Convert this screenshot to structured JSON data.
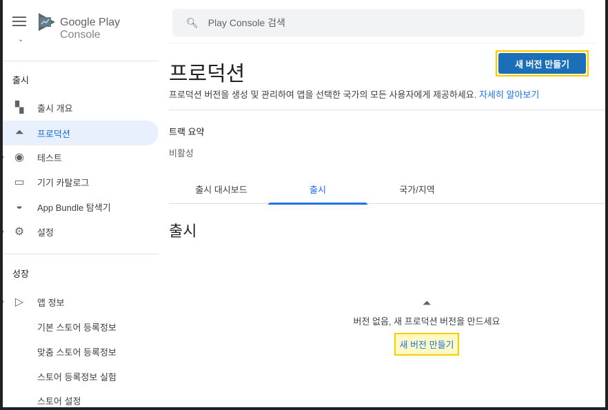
{
  "brand": {
    "name": "Google Play",
    "suffix": "Console"
  },
  "search": {
    "placeholder": "Play Console 검색"
  },
  "sidebar": {
    "release_section": "출시",
    "items": [
      {
        "label": "출시 개요"
      },
      {
        "label": "프로덕션"
      },
      {
        "label": "테스트"
      },
      {
        "label": "기기 카탈로그"
      },
      {
        "label": "App Bundle 탐색기"
      },
      {
        "label": "설정"
      }
    ],
    "growth_section": "성장",
    "growth_items": [
      {
        "label": "앱 정보"
      },
      {
        "label": "기본 스토어 등록정보"
      },
      {
        "label": "맞춤 스토어 등록정보"
      },
      {
        "label": "스토어 등록정보 실험"
      },
      {
        "label": "스토어 설정"
      }
    ]
  },
  "main": {
    "title": "프로덕션",
    "description": "프로덕션 버전을 생성 및 관리하여 앱을 선택한 국가의 모든 사용자에게 제공하세요.",
    "learn_more": "자세히 알아보기",
    "create_button": "새 버전 만들기",
    "track_summary_label": "트랙 요약",
    "track_status": "비활성",
    "tabs": [
      {
        "label": "출시 대시보드"
      },
      {
        "label": "출시"
      },
      {
        "label": "국가/지역"
      }
    ],
    "section_title": "출시",
    "empty_text": "버전 없음, 새 프로덕션 버전을 만드세요",
    "empty_button": "새 버전 만들기"
  }
}
